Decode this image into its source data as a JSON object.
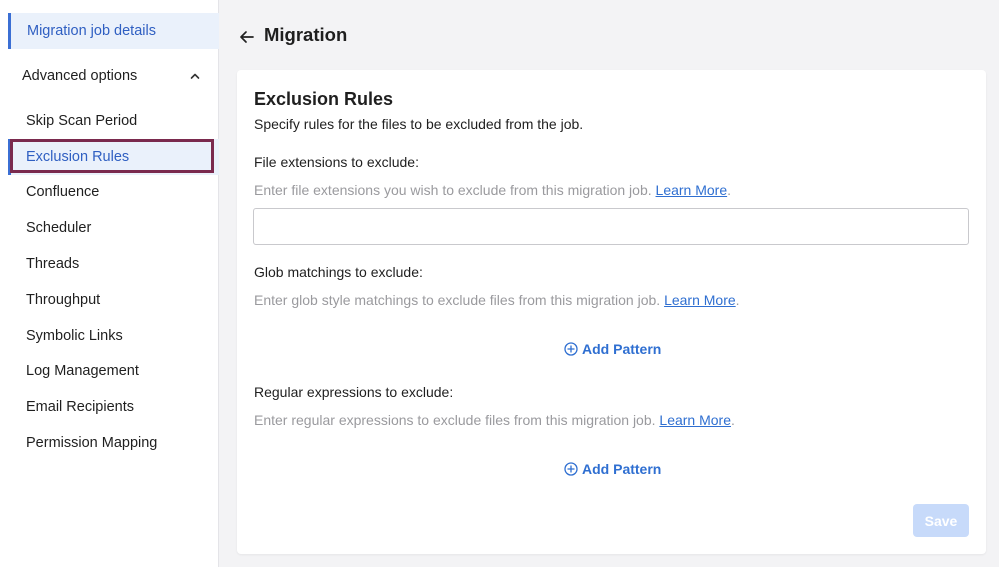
{
  "sidebar": {
    "details_label": "Migration job details",
    "advanced_label": "Advanced options",
    "items": [
      {
        "label": "Skip Scan Period"
      },
      {
        "label": "Exclusion Rules"
      },
      {
        "label": "Confluence"
      },
      {
        "label": "Scheduler"
      },
      {
        "label": "Threads"
      },
      {
        "label": "Throughput"
      },
      {
        "label": "Symbolic Links"
      },
      {
        "label": "Log Management"
      },
      {
        "label": "Email Recipients"
      },
      {
        "label": "Permission Mapping"
      }
    ]
  },
  "header": {
    "title": "Migration"
  },
  "card": {
    "title": "Exclusion Rules",
    "subtitle": "Specify rules for the files to be excluded from the job.",
    "file_ext": {
      "label": "File extensions to exclude:",
      "help": "Enter file extensions you wish to exclude from this migration job.",
      "link": "Learn More",
      "value": "",
      "placeholder": ""
    },
    "glob": {
      "label": "Glob matchings to exclude:",
      "help": "Enter glob style matchings to exclude files from this migration job.",
      "link": "Learn More",
      "add_label": "Add Pattern"
    },
    "regex": {
      "label": "Regular expressions to exclude:",
      "help": "Enter regular expressions to exclude files from this migration job.",
      "link": "Learn More",
      "add_label": "Add Pattern"
    },
    "save_label": "Save"
  },
  "colors": {
    "accent": "#2f6fd1",
    "active_bg": "#eaf1fb",
    "highlight_border": "#7a2a4e",
    "save_disabled": "#c7dafa"
  }
}
